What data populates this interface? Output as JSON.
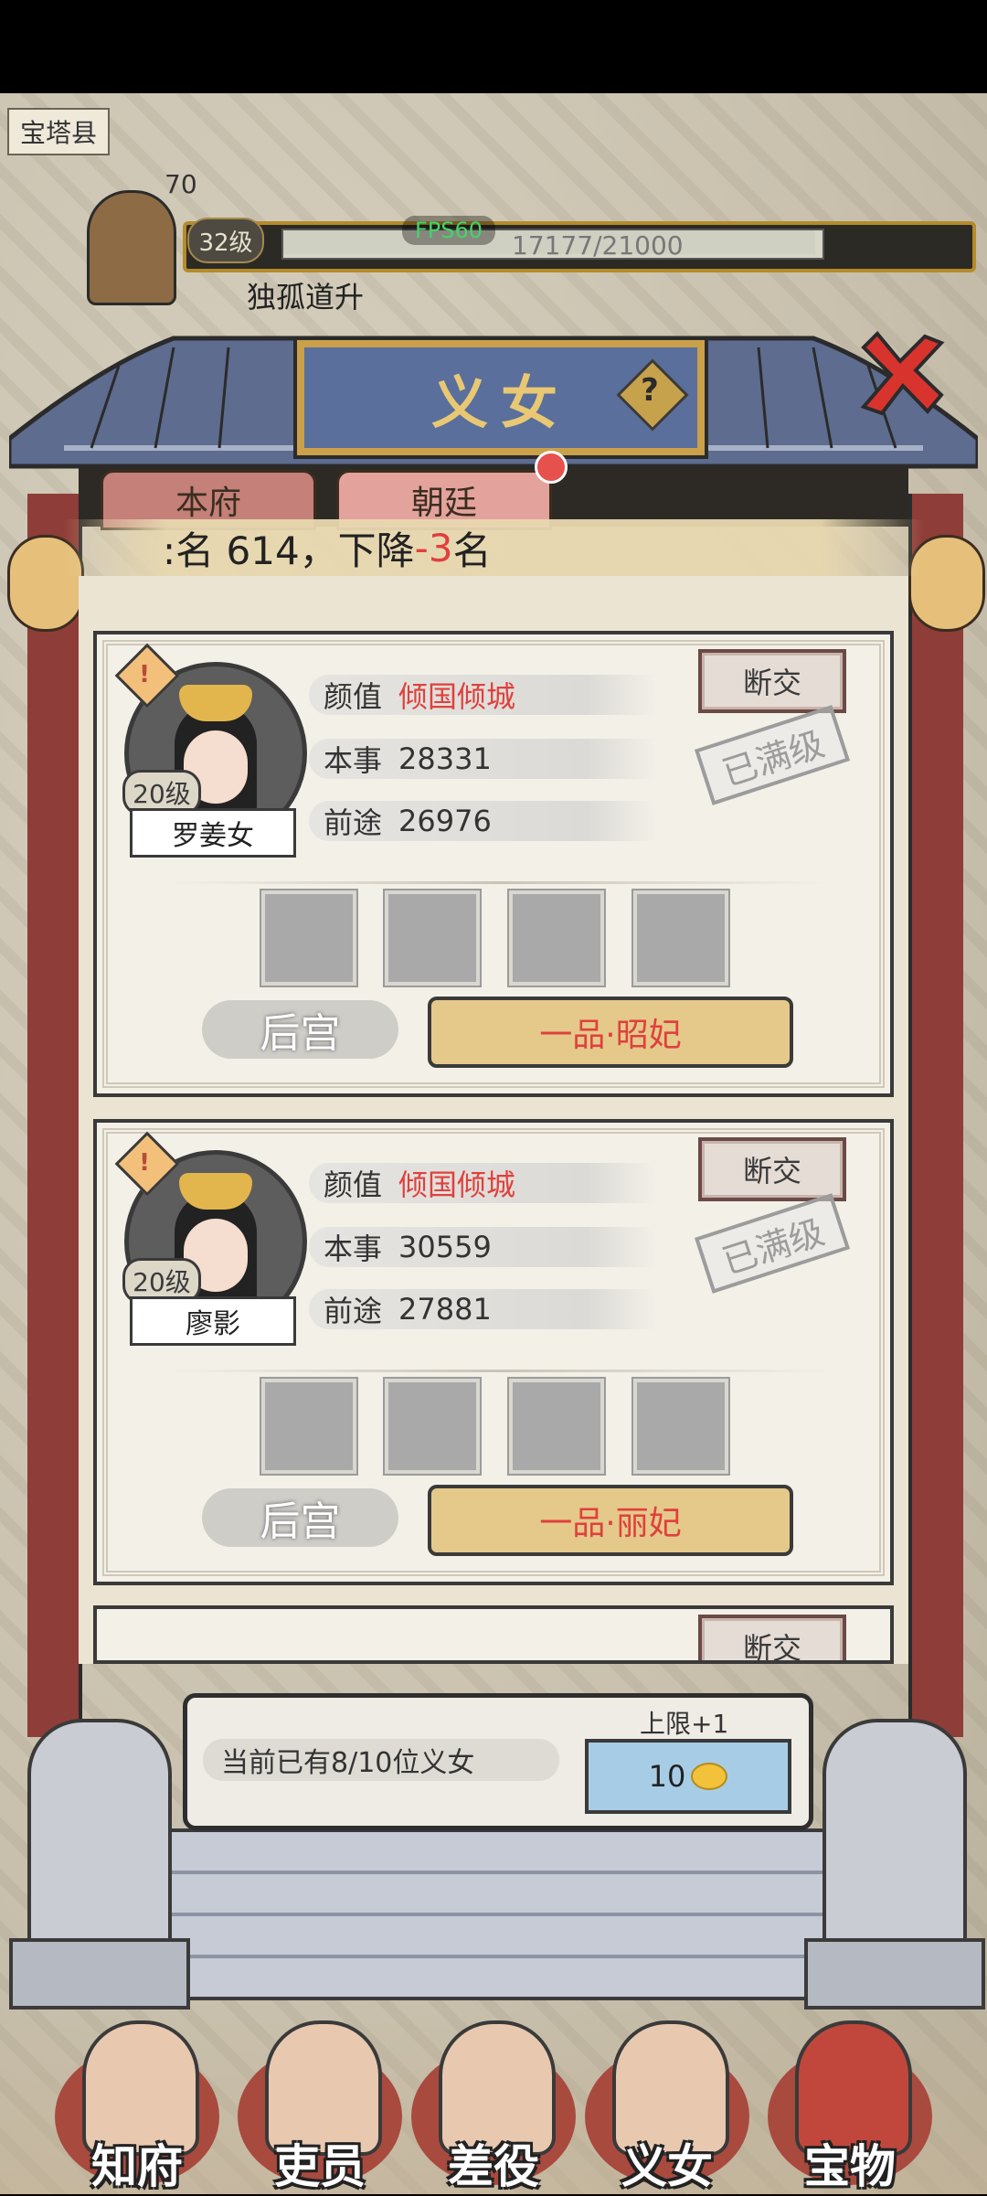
{
  "map": {
    "location": "宝塔县",
    "number": "70"
  },
  "header": {
    "level": "32级",
    "fps": "FPS60",
    "exp": "17177/21000",
    "player_name": "独孤道升"
  },
  "dialog": {
    "title": "义女",
    "help_icon": "?",
    "tabs": [
      {
        "label": "本府"
      },
      {
        "label": "朝廷"
      }
    ],
    "rank": {
      "prefix": ":名 614，下降 ",
      "change": "-3",
      "suffix": " 名"
    }
  },
  "daughters": [
    {
      "name": "罗姜女",
      "level": "20级",
      "stats": [
        {
          "label": "颜值",
          "value": "倾国倾城",
          "highlight": true
        },
        {
          "label": "本事",
          "value": "28331",
          "highlight": false
        },
        {
          "label": "前途",
          "value": "26976",
          "highlight": false
        }
      ],
      "break_label": "断交",
      "stamp": "已满级",
      "harem_label": "后宫",
      "rank_label": "一品·昭妃"
    },
    {
      "name": "廖影",
      "level": "20级",
      "stats": [
        {
          "label": "颜值",
          "value": "倾国倾城",
          "highlight": true
        },
        {
          "label": "本事",
          "value": "30559",
          "highlight": false
        },
        {
          "label": "前途",
          "value": "27881",
          "highlight": false
        }
      ],
      "break_label": "断交",
      "stamp": "已满级",
      "harem_label": "后宫",
      "rank_label": "一品·丽妃"
    }
  ],
  "partial_card": {
    "break_label": "断交"
  },
  "footer": {
    "count_text": "当前已有8/10位义女",
    "limit_label": "上限+1",
    "cost": "10",
    "cost_icon": "gold-ingot-icon"
  },
  "nav": [
    {
      "label": "知府"
    },
    {
      "label": "吏员"
    },
    {
      "label": "差役"
    },
    {
      "label": "义女"
    },
    {
      "label": "宝物"
    }
  ],
  "colors": {
    "accent_red": "#e0403d",
    "title_plate": "#5a6f9c",
    "gold": "#e9c873"
  }
}
